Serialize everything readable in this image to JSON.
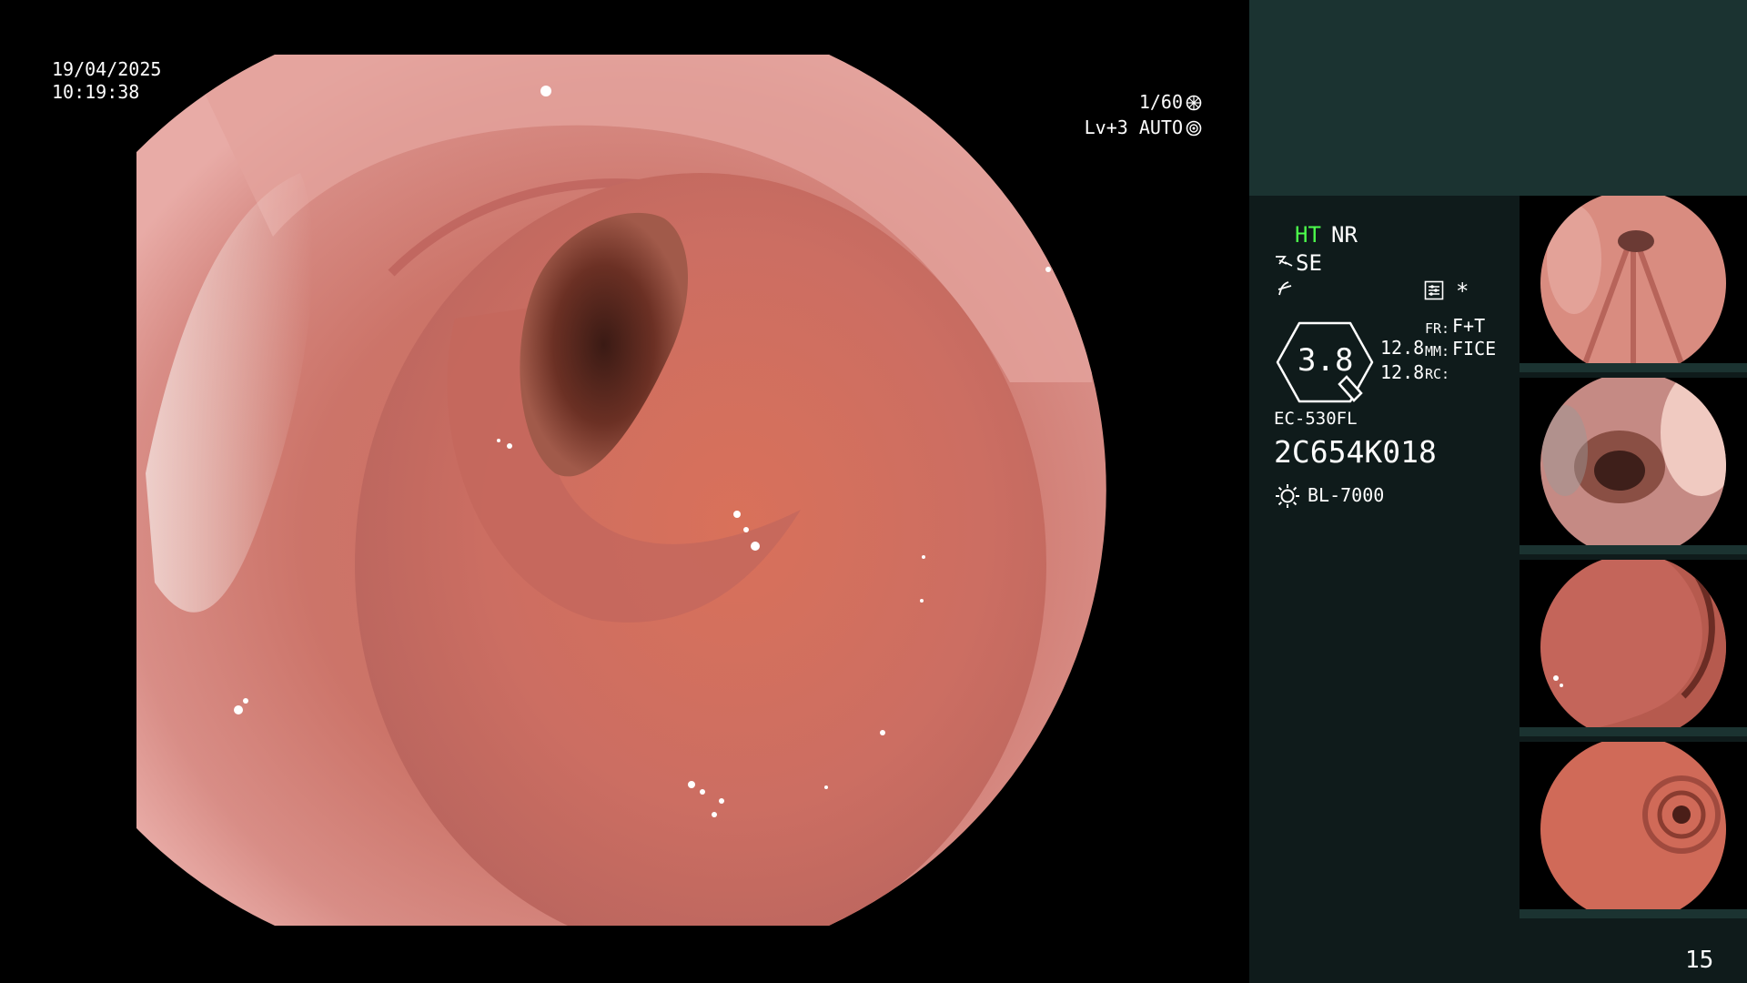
{
  "overlay": {
    "date": "19/04/2025",
    "time": "10:19:38",
    "shutter": "1/60",
    "exposure": "Lv+3 AUTO"
  },
  "info": {
    "ht": "HT",
    "nr": "NR",
    "se": "SE",
    "star": "*",
    "zoom": "3.8",
    "value_a": "12.8",
    "value_b": "12.8",
    "fr_label": "FR:",
    "fr_value": "F+T",
    "mm_label": "MM:",
    "mm_value": "FICE",
    "rc_label": "RC:",
    "scope_model": "EC-530FL",
    "scope_serial": "2C654K018",
    "light_source": "BL-7000"
  },
  "thumbnails": [
    {
      "index": 1,
      "view": "folds"
    },
    {
      "index": 2,
      "view": "lumen-near"
    },
    {
      "index": 3,
      "view": "wall-bend"
    },
    {
      "index": 4,
      "view": "lumen-far"
    }
  ],
  "frame_counter": "15",
  "colors": {
    "panel_bg": "#0f1b1b",
    "panel_header": "#1b3331",
    "ht_green": "#4cff4c",
    "mucosa": "#d07a70"
  }
}
